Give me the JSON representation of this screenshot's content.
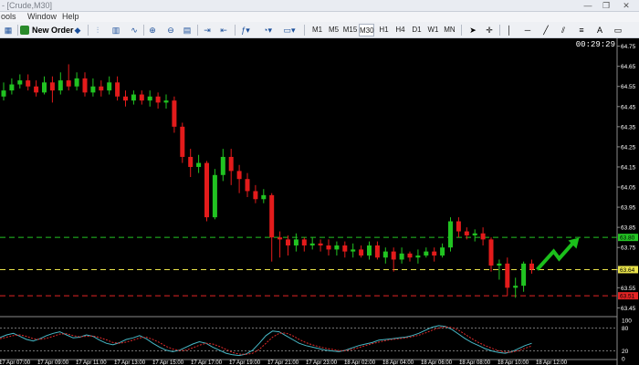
{
  "window": {
    "title": "- [Crude,M30]",
    "min_glyph": "—",
    "max_glyph": "❐",
    "close_glyph": "✕"
  },
  "menu": [
    "ools",
    "Window",
    "Help"
  ],
  "toolbar": {
    "new_order_label": "New Order",
    "timeframes": [
      "M1",
      "M5",
      "M15",
      "M30",
      "H1",
      "H4",
      "D1",
      "W1",
      "MN"
    ],
    "active_timeframe": "M30"
  },
  "clock": "00:29:29",
  "chart_data": {
    "type": "candlestick",
    "symbol": "Crude",
    "timeframe": "M30",
    "ylim": [
      63.42,
      64.78
    ],
    "price_ticks": [
      "64.75",
      "64.65",
      "64.55",
      "64.45",
      "64.35",
      "64.25",
      "64.15",
      "64.05",
      "63.95",
      "63.85",
      "63.75",
      "63.64",
      "63.55",
      "63.45"
    ],
    "time_labels": [
      "17 Apr 07:00",
      "17 Apr 09:00",
      "17 Apr 11:00",
      "17 Apr 13:00",
      "17 Apr 15:00",
      "17 Apr 17:00",
      "17 Apr 19:00",
      "17 Apr 21:00",
      "17 Apr 23:00",
      "18 Apr 02:00",
      "18 Apr 04:00",
      "18 Apr 06:00",
      "18 Apr 08:00",
      "18 Apr 10:00",
      "18 Apr 12:00"
    ],
    "candles": [
      [
        64.5,
        64.53,
        64.57,
        64.48
      ],
      [
        64.53,
        64.56,
        64.59,
        64.51
      ],
      [
        64.56,
        64.58,
        64.61,
        64.54
      ],
      [
        64.58,
        64.55,
        64.61,
        64.53
      ],
      [
        64.55,
        64.52,
        64.58,
        64.5
      ],
      [
        64.52,
        64.57,
        64.6,
        64.51
      ],
      [
        64.57,
        64.53,
        64.6,
        64.47
      ],
      [
        64.53,
        64.58,
        64.62,
        64.51
      ],
      [
        64.58,
        64.55,
        64.66,
        64.53
      ],
      [
        64.55,
        64.59,
        64.62,
        64.53
      ],
      [
        64.59,
        64.52,
        64.62,
        64.5
      ],
      [
        64.52,
        64.55,
        64.59,
        64.5
      ],
      [
        64.55,
        64.53,
        64.58,
        64.5
      ],
      [
        64.53,
        64.57,
        64.6,
        64.51
      ],
      [
        64.57,
        64.5,
        64.6,
        64.48
      ],
      [
        64.5,
        64.48,
        64.53,
        64.45
      ],
      [
        64.48,
        64.51,
        64.53,
        64.46
      ],
      [
        64.51,
        64.48,
        64.53,
        64.46
      ],
      [
        64.48,
        64.5,
        64.53,
        64.45
      ],
      [
        64.5,
        64.47,
        64.52,
        64.44
      ],
      [
        64.47,
        64.48,
        64.51,
        64.44
      ],
      [
        64.48,
        64.35,
        64.5,
        64.32
      ],
      [
        64.35,
        64.2,
        64.37,
        64.17
      ],
      [
        64.2,
        64.15,
        64.24,
        64.1
      ],
      [
        64.15,
        64.17,
        64.21,
        64.12
      ],
      [
        64.17,
        63.9,
        64.18,
        63.88
      ],
      [
        63.9,
        64.11,
        64.14,
        63.89
      ],
      [
        64.11,
        64.2,
        64.24,
        64.08
      ],
      [
        64.2,
        64.13,
        64.24,
        64.06
      ],
      [
        64.13,
        64.09,
        64.16,
        64.02
      ],
      [
        64.09,
        64.03,
        64.12,
        64.0
      ],
      [
        64.03,
        63.99,
        64.06,
        63.97
      ],
      [
        63.99,
        64.01,
        64.04,
        63.97
      ],
      [
        64.01,
        63.8,
        64.02,
        63.68
      ],
      [
        63.8,
        63.79,
        63.83,
        63.7
      ],
      [
        63.79,
        63.76,
        63.81,
        63.71
      ],
      [
        63.76,
        63.79,
        63.82,
        63.73
      ],
      [
        63.79,
        63.76,
        63.8,
        63.73
      ],
      [
        63.76,
        63.77,
        63.8,
        63.74
      ],
      [
        63.77,
        63.76,
        63.79,
        63.73
      ],
      [
        63.76,
        63.74,
        63.79,
        63.71
      ],
      [
        63.74,
        63.76,
        63.78,
        63.71
      ],
      [
        63.76,
        63.73,
        63.78,
        63.7
      ],
      [
        63.73,
        63.74,
        63.77,
        63.7
      ],
      [
        63.74,
        63.71,
        63.76,
        63.7
      ],
      [
        63.71,
        63.76,
        63.78,
        63.69
      ],
      [
        63.76,
        63.7,
        63.78,
        63.69
      ],
      [
        63.7,
        63.73,
        63.75,
        63.67
      ],
      [
        63.73,
        63.69,
        63.75,
        63.63
      ],
      [
        63.69,
        63.72,
        63.75,
        63.67
      ],
      [
        63.72,
        63.7,
        63.73,
        63.68
      ],
      [
        63.7,
        63.71,
        63.74,
        63.67
      ],
      [
        63.71,
        63.73,
        63.75,
        63.7
      ],
      [
        63.73,
        63.71,
        63.75,
        63.68
      ],
      [
        63.71,
        63.75,
        63.77,
        63.7
      ],
      [
        63.75,
        63.88,
        63.9,
        63.73
      ],
      [
        63.88,
        63.83,
        63.9,
        63.8
      ],
      [
        63.83,
        63.81,
        63.85,
        63.79
      ],
      [
        63.81,
        63.82,
        63.84,
        63.78
      ],
      [
        63.82,
        63.79,
        63.85,
        63.76
      ],
      [
        63.79,
        63.66,
        63.8,
        63.63
      ],
      [
        63.66,
        63.67,
        63.69,
        63.59
      ],
      [
        63.67,
        63.55,
        63.7,
        63.51
      ],
      [
        63.55,
        63.56,
        63.6,
        63.5
      ],
      [
        63.56,
        63.67,
        63.68,
        63.53
      ],
      [
        63.67,
        63.64,
        63.69,
        63.62
      ]
    ],
    "levels": [
      {
        "price": 63.8,
        "color": "#23c423",
        "style": "dashed",
        "label": "63.80"
      },
      {
        "price": 63.64,
        "color": "#e8e24a",
        "style": "dashed",
        "label": "63.64"
      },
      {
        "price": 63.51,
        "color": "#e22424",
        "style": "dashed",
        "label": "63.51"
      }
    ],
    "stoch_ticks": [
      "100",
      "80",
      "20",
      "0"
    ],
    "stoch_k": [
      55,
      62,
      66,
      58,
      50,
      46,
      52,
      60,
      66,
      70,
      62,
      54,
      56,
      62,
      58,
      48,
      40,
      36,
      42,
      50,
      54,
      60,
      52,
      40,
      30,
      22,
      18,
      22,
      30,
      38,
      44,
      40,
      30,
      22,
      14,
      10,
      8,
      12,
      22,
      40,
      60,
      72,
      70,
      60,
      50,
      40,
      34,
      30,
      26,
      22,
      20,
      18,
      22,
      28,
      34,
      38,
      42,
      48,
      50,
      52,
      54,
      56,
      60,
      66,
      74,
      82,
      86,
      84,
      76,
      64,
      52,
      42,
      34,
      26,
      20,
      16,
      14,
      18,
      26,
      34,
      40
    ],
    "stoch_d": [
      52,
      56,
      60,
      62,
      58,
      52,
      50,
      53,
      58,
      64,
      65,
      60,
      57,
      58,
      59,
      55,
      49,
      42,
      40,
      43,
      48,
      54,
      56,
      50,
      42,
      32,
      25,
      21,
      22,
      28,
      35,
      40,
      38,
      32,
      24,
      16,
      12,
      11,
      14,
      24,
      40,
      56,
      66,
      67,
      60,
      50,
      42,
      36,
      31,
      27,
      24,
      21,
      21,
      24,
      29,
      34,
      39,
      43,
      47,
      50,
      52,
      54,
      57,
      61,
      67,
      74,
      80,
      83,
      81,
      74,
      63,
      52,
      42,
      34,
      27,
      21,
      17,
      17,
      21,
      27,
      33
    ],
    "stoch_levels": [
      80,
      20
    ],
    "colors": {
      "bull": "#21c321",
      "bear": "#e31b1b",
      "stoch_k": "#47b8c6",
      "stoch_d": "#e02a2a",
      "arrow": "#1bbf1b"
    }
  }
}
